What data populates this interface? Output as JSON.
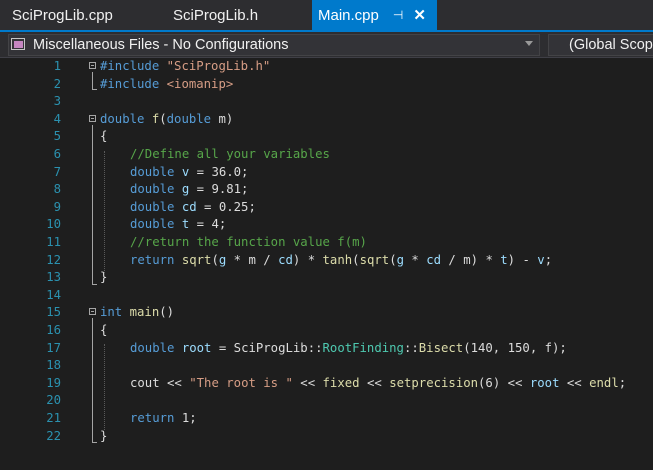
{
  "tabs": [
    {
      "label": "SciProgLib.cpp",
      "active": false
    },
    {
      "label": "SciProgLib.h",
      "active": false
    },
    {
      "label": "Main.cpp",
      "active": true
    }
  ],
  "tab_icons": {
    "pin": "pin-icon",
    "close": "close-icon"
  },
  "navbar": {
    "project_scope": "Miscellaneous Files - No Configurations",
    "member_scope": "(Global Scope)"
  },
  "colors": {
    "accent": "#007acc",
    "keyword": "#569cd6",
    "string": "#d69d85",
    "comment": "#57a64a",
    "function": "#dcdcaa",
    "type": "#4ec9b0",
    "line_number": "#2b91af"
  },
  "editor": {
    "line_numbers": [
      "1",
      "2",
      "3",
      "4",
      "5",
      "6",
      "7",
      "8",
      "9",
      "10",
      "11",
      "12",
      "13",
      "14",
      "15",
      "16",
      "17",
      "18",
      "19",
      "20",
      "21",
      "22"
    ],
    "tokens": {
      "l1": [
        "#include ",
        "\"SciProgLib.h\""
      ],
      "l2": [
        "#include ",
        "<iomanip>"
      ],
      "l4": [
        "double",
        " ",
        "f",
        "(",
        "double",
        " m)"
      ],
      "l5": [
        "{"
      ],
      "l6": [
        "//Define all your variables"
      ],
      "l7": [
        "double",
        " ",
        "v",
        " = 36.0;"
      ],
      "l8": [
        "double",
        " ",
        "g",
        " = 9.81;"
      ],
      "l9": [
        "double",
        " ",
        "cd",
        " = 0.25;"
      ],
      "l10": [
        "double",
        " ",
        "t",
        " = 4;"
      ],
      "l11": [
        "//return the function value f(m)"
      ],
      "l12": [
        "return",
        " ",
        "sqrt",
        "(",
        "g",
        " * m / ",
        "cd",
        ") * ",
        "tanh",
        "(",
        "sqrt",
        "(",
        "g",
        " * ",
        "cd",
        " / m) * ",
        "t",
        ") - ",
        "v",
        ";"
      ],
      "l13": [
        "}"
      ],
      "l15": [
        "int",
        " ",
        "main",
        "()"
      ],
      "l16": [
        "{"
      ],
      "l17": [
        "double",
        " ",
        "root",
        " = SciProgLib::",
        "RootFinding",
        "::",
        "Bisect",
        "(140, 150, f);"
      ],
      "l19": [
        "cout",
        " << ",
        "\"The root is \"",
        " << ",
        "fixed",
        " << ",
        "setprecision",
        "(6) << ",
        "root",
        " << ",
        "endl",
        ";"
      ],
      "l21": [
        "return",
        " 1;"
      ],
      "l22": [
        "}"
      ]
    }
  }
}
